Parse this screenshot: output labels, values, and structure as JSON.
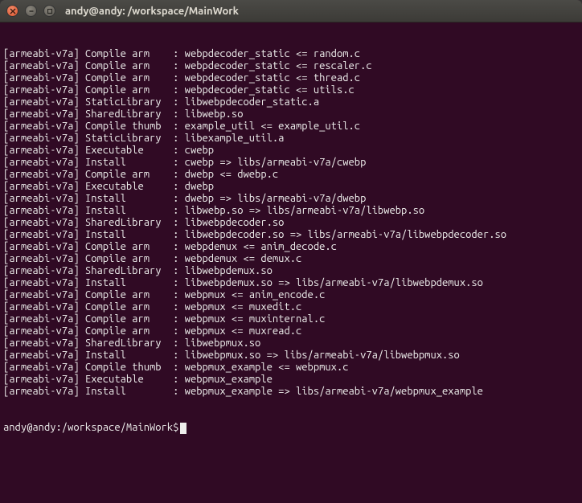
{
  "window": {
    "title": "andy@andy: /workspace/MainWork"
  },
  "icons": {
    "close": "x",
    "minimize": "-",
    "maximize": "□"
  },
  "terminal": {
    "lines": [
      "[armeabi-v7a] Compile arm    : webpdecoder_static <= random.c",
      "[armeabi-v7a] Compile arm    : webpdecoder_static <= rescaler.c",
      "[armeabi-v7a] Compile arm    : webpdecoder_static <= thread.c",
      "[armeabi-v7a] Compile arm    : webpdecoder_static <= utils.c",
      "[armeabi-v7a] StaticLibrary  : libwebpdecoder_static.a",
      "[armeabi-v7a] SharedLibrary  : libwebp.so",
      "[armeabi-v7a] Compile thumb  : example_util <= example_util.c",
      "[armeabi-v7a] StaticLibrary  : libexample_util.a",
      "[armeabi-v7a] Executable     : cwebp",
      "[armeabi-v7a] Install        : cwebp => libs/armeabi-v7a/cwebp",
      "[armeabi-v7a] Compile arm    : dwebp <= dwebp.c",
      "[armeabi-v7a] Executable     : dwebp",
      "[armeabi-v7a] Install        : dwebp => libs/armeabi-v7a/dwebp",
      "[armeabi-v7a] Install        : libwebp.so => libs/armeabi-v7a/libwebp.so",
      "[armeabi-v7a] SharedLibrary  : libwebpdecoder.so",
      "[armeabi-v7a] Install        : libwebpdecoder.so => libs/armeabi-v7a/libwebpdecoder.so",
      "[armeabi-v7a] Compile arm    : webpdemux <= anim_decode.c",
      "[armeabi-v7a] Compile arm    : webpdemux <= demux.c",
      "[armeabi-v7a] SharedLibrary  : libwebpdemux.so",
      "[armeabi-v7a] Install        : libwebpdemux.so => libs/armeabi-v7a/libwebpdemux.so",
      "[armeabi-v7a] Compile arm    : webpmux <= anim_encode.c",
      "[armeabi-v7a] Compile arm    : webpmux <= muxedit.c",
      "[armeabi-v7a] Compile arm    : webpmux <= muxinternal.c",
      "[armeabi-v7a] Compile arm    : webpmux <= muxread.c",
      "[armeabi-v7a] SharedLibrary  : libwebpmux.so",
      "[armeabi-v7a] Install        : libwebpmux.so => libs/armeabi-v7a/libwebpmux.so",
      "[armeabi-v7a] Compile thumb  : webpmux_example <= webpmux.c",
      "[armeabi-v7a] Executable     : webpmux_example",
      "[armeabi-v7a] Install        : webpmux_example => libs/armeabi-v7a/webpmux_example"
    ],
    "prompt": "andy@andy:/workspace/MainWork$"
  }
}
